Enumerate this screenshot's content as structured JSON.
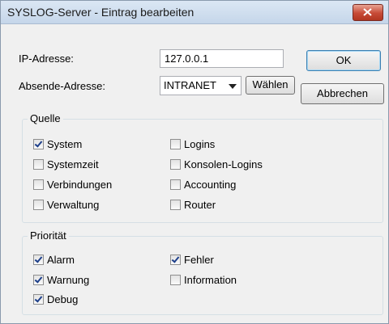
{
  "window": {
    "title": "SYSLOG-Server - Eintrag bearbeiten"
  },
  "form": {
    "ip_label": "IP-Adresse:",
    "ip_value": "127.0.0.1",
    "sender_label": "Absende-Adresse:",
    "sender_value": "INTRANET",
    "choose_label": "Wählen"
  },
  "buttons": {
    "ok": "OK",
    "cancel": "Abbrechen"
  },
  "source_group": {
    "title": "Quelle",
    "items": [
      {
        "label": "System",
        "checked": true
      },
      {
        "label": "Systemzeit",
        "checked": false
      },
      {
        "label": "Verbindungen",
        "checked": false
      },
      {
        "label": "Verwaltung",
        "checked": false
      },
      {
        "label": "Logins",
        "checked": false
      },
      {
        "label": "Konsolen-Logins",
        "checked": false
      },
      {
        "label": "Accounting",
        "checked": false
      },
      {
        "label": "Router",
        "checked": false
      }
    ]
  },
  "priority_group": {
    "title": "Priorität",
    "items": [
      {
        "label": "Alarm",
        "checked": true
      },
      {
        "label": "Warnung",
        "checked": true
      },
      {
        "label": "Debug",
        "checked": true
      },
      {
        "label": "Fehler",
        "checked": true
      },
      {
        "label": "Information",
        "checked": false
      }
    ]
  }
}
